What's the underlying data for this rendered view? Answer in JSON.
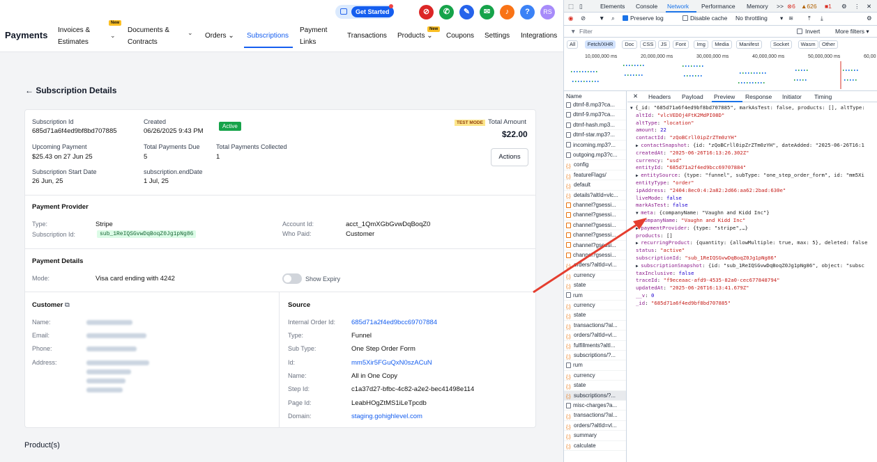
{
  "app": {
    "brand": "Payments"
  },
  "nav": {
    "items": [
      {
        "label_1": "Invoices &",
        "label_2": "Estimates",
        "new": true
      },
      {
        "label_1": "Documents &",
        "label_2": "Contracts"
      },
      {
        "label": "Orders"
      },
      {
        "label": "Subscriptions",
        "active": true
      },
      {
        "label_1": "Payment",
        "label_2": "Links"
      },
      {
        "label": "Transactions"
      },
      {
        "label": "Products",
        "new": true
      },
      {
        "label": "Coupons"
      },
      {
        "label": "Settings"
      },
      {
        "label": "Integrations"
      }
    ],
    "new_tag": "New",
    "get_started": "Get Started",
    "avatar": "RS",
    "help": "?"
  },
  "page": {
    "title": "Subscription Details",
    "back_icon": "arrow-left-icon"
  },
  "summary": {
    "subscription_id_label": "Subscription Id",
    "subscription_id": "685d71a6f4ed9bf8bd707885",
    "created_label": "Created",
    "created": "06/26/2025 9:43 PM",
    "status": "Active",
    "test_mode": "TEST MODE",
    "total_amount_label": "Total Amount",
    "total_amount": "$22.00",
    "upcoming_label": "Upcoming Payment",
    "upcoming": "$25.43 on 27 Jun 25",
    "total_due_label": "Total Payments Due",
    "total_due": "5",
    "total_collected_label": "Total Payments Collected",
    "total_collected": "1",
    "start_label": "Subscription Start Date",
    "start": "26 Jun, 25",
    "end_label": "subscription.endDate",
    "end": "1 Jul, 25",
    "actions": "Actions"
  },
  "provider": {
    "heading": "Payment Provider",
    "type_label": "Type:",
    "type": "Stripe",
    "subid_label": "Subscription Id:",
    "subid": "sub_1ReIQSGvwDqBoqZ0Jg1pNg86",
    "account_label": "Account Id:",
    "account": "acct_1QmXGbGvwDqBoqZ0",
    "who_label": "Who Paid:",
    "who": "Customer"
  },
  "payment_details": {
    "heading": "Payment Details",
    "mode_label": "Mode:",
    "mode": "Visa card ending with 4242",
    "show_expiry": "Show Expiry"
  },
  "customer": {
    "heading": "Customer",
    "name_label": "Name:",
    "email_label": "Email:",
    "phone_label": "Phone:",
    "address_label": "Address:"
  },
  "source": {
    "heading": "Source",
    "internal_label": "Internal Order Id:",
    "internal": "685d71a2f4ed9bcc69707884",
    "type_label": "Type:",
    "type": "Funnel",
    "subtype_label": "Sub Type:",
    "subtype": "One Step Order Form",
    "id_label": "Id:",
    "id": "mm5Xir5FGuQxN0szACuN",
    "name_label": "Name:",
    "name": "All in One Copy",
    "step_label": "Step Id:",
    "step": "c1a37d27-bfbc-4c82-a2e2-bec41498e114",
    "pageid_label": "Page Id:",
    "pageid": "LeabHOgZtMS1iLeTpcdb",
    "domain_label": "Domain:",
    "domain": "staging.gohighlevel.com"
  },
  "products_heading": "Product(s)",
  "devtools": {
    "tabs": [
      "Elements",
      "Console",
      "Network",
      "Performance",
      "Memory"
    ],
    "more": ">>",
    "errors": "6",
    "warnings": "626",
    "info": "1",
    "preserve_log": "Preserve log",
    "disable_cache": "Disable cache",
    "throttling": "No throttling",
    "filter_placeholder": "Filter",
    "invert": "Invert",
    "more_filters": "More filters",
    "chips": [
      "All",
      "Fetch/XHR",
      "Doc",
      "CSS",
      "JS",
      "Font",
      "Img",
      "Media",
      "Manifest",
      "Socket",
      "Wasm",
      "Other"
    ],
    "timeline": [
      "10,000,000 ms",
      "20,000,000 ms",
      "30,000,000 ms",
      "40,000,000 ms",
      "50,000,000 ms",
      "60,00"
    ],
    "name_header": "Name",
    "detail_tabs": [
      "Headers",
      "Payload",
      "Preview",
      "Response",
      "Initiator",
      "Timing"
    ],
    "requests": [
      {
        "name": "dtmf-8.mp3?ca...",
        "t": "doc"
      },
      {
        "name": "dtmf-9.mp3?ca...",
        "t": "doc"
      },
      {
        "name": "dtmf-hash.mp3...",
        "t": "doc"
      },
      {
        "name": "dtmf-star.mp3?...",
        "t": "doc"
      },
      {
        "name": "incoming.mp3?...",
        "t": "doc"
      },
      {
        "name": "outgoing.mp3?c...",
        "t": "doc"
      },
      {
        "name": "config",
        "t": "xhr"
      },
      {
        "name": "featureFlags/",
        "t": "xhr"
      },
      {
        "name": "default",
        "t": "xhr"
      },
      {
        "name": "details?altId=vlc...",
        "t": "xhr"
      },
      {
        "name": "channel?gsessi...",
        "t": "box"
      },
      {
        "name": "channel?gsessi...",
        "t": "box"
      },
      {
        "name": "channel?gsessi...",
        "t": "box"
      },
      {
        "name": "channel?gsessi...",
        "t": "box"
      },
      {
        "name": "channel?gsessi...",
        "t": "box"
      },
      {
        "name": "channel?gsessi...",
        "t": "box"
      },
      {
        "name": "orders/?altId=vl...",
        "t": "xhr"
      },
      {
        "name": "currency",
        "t": "xhr"
      },
      {
        "name": "state",
        "t": "xhr"
      },
      {
        "name": "rum",
        "t": "doc"
      },
      {
        "name": "currency",
        "t": "xhr"
      },
      {
        "name": "state",
        "t": "xhr"
      },
      {
        "name": "transactions/?al...",
        "t": "xhr"
      },
      {
        "name": "orders/?altId=vl...",
        "t": "xhr"
      },
      {
        "name": "fulfillments?altI...",
        "t": "xhr"
      },
      {
        "name": "subscriptions/?...",
        "t": "xhr"
      },
      {
        "name": "rum",
        "t": "doc"
      },
      {
        "name": "currency",
        "t": "xhr"
      },
      {
        "name": "state",
        "t": "xhr"
      },
      {
        "name": "subscriptions/?...",
        "t": "xhr",
        "sel": true
      },
      {
        "name": "misc-charges?a...",
        "t": "doc"
      },
      {
        "name": "transactions/?al...",
        "t": "xhr"
      },
      {
        "name": "orders/?altId=vl...",
        "t": "xhr"
      },
      {
        "name": "summary",
        "t": "xhr"
      },
      {
        "name": "calculate",
        "t": "xhr"
      }
    ],
    "preview": [
      {
        "i": 0,
        "tri": "▼",
        "text": "{_id: \"685d71a6f4ed9bf8bd707885\", markAsTest: false, products: [], altType:",
        "c": "p"
      },
      {
        "i": 1,
        "k": "altId",
        "v": "\"vlcVEDOj4FtK2MdPI08D\"",
        "c": "s"
      },
      {
        "i": 1,
        "k": "altType",
        "v": "\"location\"",
        "c": "s"
      },
      {
        "i": 1,
        "k": "amount",
        "v": "22",
        "c": "n"
      },
      {
        "i": 1,
        "k": "contactId",
        "v": "\"zQoBCrll0ipZrZTm0zYH\"",
        "c": "s"
      },
      {
        "i": 1,
        "tri": "▶",
        "k": "contactSnapshot",
        "v": "{id: \"zQoBCrll0ipZrZTm0zYH\", dateAdded: \"2025-06-26T16:1",
        "c": "p"
      },
      {
        "i": 1,
        "k": "createdAt",
        "v": "\"2025-06-26T16:13:26.302Z\"",
        "c": "s"
      },
      {
        "i": 1,
        "k": "currency",
        "v": "\"usd\"",
        "c": "s"
      },
      {
        "i": 1,
        "k": "entityId",
        "v": "\"685d71a2f4ed9bcc69707884\"",
        "c": "s"
      },
      {
        "i": 1,
        "tri": "▶",
        "k": "entitySource",
        "v": "{type: \"funnel\", subType: \"one_step_order_form\", id: \"mm5Xi",
        "c": "p"
      },
      {
        "i": 1,
        "k": "entityType",
        "v": "\"order\"",
        "c": "s"
      },
      {
        "i": 1,
        "k": "ipAddress",
        "v": "\"2404:8ec0:4:2a82:2d66:aa62:2bad:630e\"",
        "c": "s"
      },
      {
        "i": 1,
        "k": "liveMode",
        "v": "false",
        "c": "n"
      },
      {
        "i": 1,
        "k": "markAsTest",
        "v": "false",
        "c": "n"
      },
      {
        "i": 1,
        "tri": "▼",
        "k": "meta",
        "v": "{companyName: \"Vaughn and Kidd Inc\"}",
        "c": "p"
      },
      {
        "i": 2,
        "k": "companyName",
        "v": "\"Vaughn and Kidd Inc\"",
        "c": "s"
      },
      {
        "i": 1,
        "tri": "▶",
        "k": "paymentProvider",
        "v": "{type: \"stripe\",…}",
        "c": "p"
      },
      {
        "i": 1,
        "k": "products",
        "v": "[]",
        "c": "p"
      },
      {
        "i": 1,
        "tri": "▶",
        "k": "recurringProduct",
        "v": "{quantity: {allowMultiple: true, max: 5}, deleted: false",
        "c": "p"
      },
      {
        "i": 1,
        "k": "status",
        "v": "\"active\"",
        "c": "s"
      },
      {
        "i": 1,
        "k": "subscriptionId",
        "v": "\"sub_1ReIQSGvwDqBoqZ0Jg1pNg86\"",
        "c": "s"
      },
      {
        "i": 1,
        "tri": "▶",
        "k": "subscriptionSnapshot",
        "v": "{id: \"sub_1ReIQSGvwDqBoqZ0Jg1pNg86\", object: \"subsc",
        "c": "p"
      },
      {
        "i": 1,
        "k": "taxInclusive",
        "v": "false",
        "c": "n"
      },
      {
        "i": 1,
        "k": "traceId",
        "v": "\"f9eceaac-afd9-4535-82a0-cec677848794\"",
        "c": "s"
      },
      {
        "i": 1,
        "k": "updatedAt",
        "v": "\"2025-06-26T16:13:41.679Z\"",
        "c": "s"
      },
      {
        "i": 1,
        "k": "__v",
        "v": "0",
        "c": "n"
      },
      {
        "i": 1,
        "k": "_id",
        "v": "\"685d71a6f4ed9bf8bd707885\"",
        "c": "s"
      }
    ]
  },
  "colors": {
    "primary": "#155eef",
    "active": "#16a34a",
    "arrow": "#e53e2f"
  }
}
